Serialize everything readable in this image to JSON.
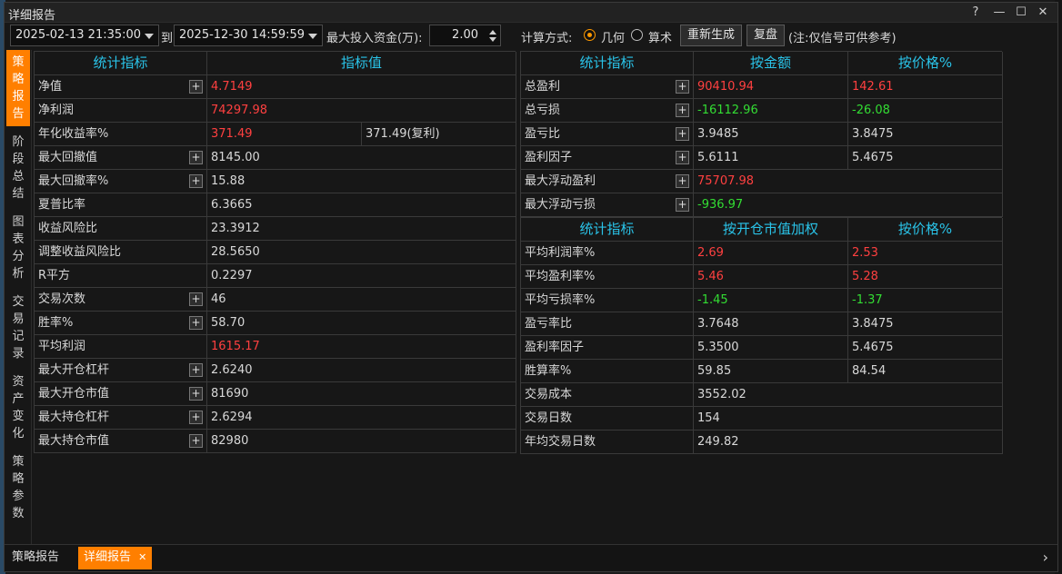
{
  "window": {
    "title": "详细报告"
  },
  "toolbar": {
    "start_datetime": "2025-02-13 21:35:00",
    "to_label": "到",
    "end_datetime": "2025-12-30 14:59:59",
    "max_capital_label": "最大投入资金(万):",
    "max_capital_value": "2.00",
    "calc_method_label": "计算方式:",
    "option_geometric": "几何",
    "option_arithmetic": "算术",
    "selected_method": "几何",
    "regenerate_label": "重新生成",
    "review_label": "复盘",
    "note": "(注:仅信号可供参考)"
  },
  "side_tabs": [
    {
      "label": "策略报告",
      "active": true
    },
    {
      "label": "阶段总结",
      "active": false
    },
    {
      "label": "图表分析",
      "active": false
    },
    {
      "label": "交易记录",
      "active": false
    },
    {
      "label": "资产变化",
      "active": false
    },
    {
      "label": "策略参数",
      "active": false
    }
  ],
  "left_table": {
    "headers": [
      "统计指标",
      "指标值"
    ],
    "rows": [
      {
        "name": "净值",
        "value": "4.7149",
        "extra": "",
        "plus": true,
        "color": "red"
      },
      {
        "name": "净利润",
        "value": "74297.98",
        "extra": "",
        "plus": false,
        "color": "red"
      },
      {
        "name": "年化收益率%",
        "value": "371.49",
        "extra": "371.49(复利)",
        "plus": false,
        "color": "red"
      },
      {
        "name": "最大回撤值",
        "value": "8145.00",
        "extra": "",
        "plus": true,
        "color": ""
      },
      {
        "name": "最大回撤率%",
        "value": "15.88",
        "extra": "",
        "plus": true,
        "color": ""
      },
      {
        "name": "夏普比率",
        "value": "6.3665",
        "extra": "",
        "plus": false,
        "color": ""
      },
      {
        "name": "收益风险比",
        "value": "23.3912",
        "extra": "",
        "plus": false,
        "color": ""
      },
      {
        "name": "调整收益风险比",
        "value": "28.5650",
        "extra": "",
        "plus": false,
        "color": ""
      },
      {
        "name": "R平方",
        "value": "0.2297",
        "extra": "",
        "plus": false,
        "color": ""
      },
      {
        "name": "交易次数",
        "value": "46",
        "extra": "",
        "plus": true,
        "color": ""
      },
      {
        "name": "胜率%",
        "value": "58.70",
        "extra": "",
        "plus": true,
        "color": ""
      },
      {
        "name": "平均利润",
        "value": "1615.17",
        "extra": "",
        "plus": false,
        "color": "red"
      },
      {
        "name": "最大开仓杠杆",
        "value": "2.6240",
        "extra": "",
        "plus": true,
        "color": ""
      },
      {
        "name": "最大开仓市值",
        "value": "81690",
        "extra": "",
        "plus": true,
        "color": ""
      },
      {
        "name": "最大持仓杠杆",
        "value": "2.6294",
        "extra": "",
        "plus": true,
        "color": ""
      },
      {
        "name": "最大持仓市值",
        "value": "82980",
        "extra": "",
        "plus": true,
        "color": ""
      }
    ]
  },
  "right_table_top": {
    "headers": [
      "统计指标",
      "按金额",
      "按价格%"
    ],
    "rows": [
      {
        "name": "总盈利",
        "amount": "90410.94",
        "price": "142.61",
        "plus": true,
        "color": "red"
      },
      {
        "name": "总亏损",
        "amount": "-16112.96",
        "price": "-26.08",
        "plus": true,
        "color": "green"
      },
      {
        "name": "盈亏比",
        "amount": "3.9485",
        "price": "3.8475",
        "plus": true,
        "color": ""
      },
      {
        "name": "盈利因子",
        "amount": "5.6111",
        "price": "5.4675",
        "plus": true,
        "color": ""
      },
      {
        "name": "最大浮动盈利",
        "amount": "75707.98",
        "price": "",
        "plus": true,
        "color": "red"
      },
      {
        "name": "最大浮动亏损",
        "amount": "-936.97",
        "price": "",
        "plus": true,
        "color": "green"
      }
    ]
  },
  "right_table_bottom": {
    "headers": [
      "统计指标",
      "按开仓市值加权",
      "按价格%"
    ],
    "rows": [
      {
        "name": "平均利润率%",
        "weighted": "2.69",
        "price": "2.53",
        "color": "red"
      },
      {
        "name": "平均盈利率%",
        "weighted": "5.46",
        "price": "5.28",
        "color": "red"
      },
      {
        "name": "平均亏损率%",
        "weighted": "-1.45",
        "price": "-1.37",
        "color": "green"
      },
      {
        "name": "盈亏率比",
        "weighted": "3.7648",
        "price": "3.8475",
        "color": ""
      },
      {
        "name": "盈利率因子",
        "weighted": "5.3500",
        "price": "5.4675",
        "color": ""
      },
      {
        "name": "胜算率%",
        "weighted": "59.85",
        "price": "84.54",
        "color": ""
      },
      {
        "name": "交易成本",
        "weighted": "3552.02",
        "price": "",
        "color": ""
      },
      {
        "name": "交易日数",
        "weighted": "154",
        "price": "",
        "color": ""
      },
      {
        "name": "年均交易日数",
        "weighted": "249.82",
        "price": "",
        "color": ""
      }
    ]
  },
  "bottom_tabs": [
    {
      "label": "策略报告",
      "active": false,
      "closable": false
    },
    {
      "label": "详细报告",
      "active": true,
      "closable": true
    }
  ],
  "colors": {
    "accent": "#ff7f00",
    "header_text": "#2ac3e8",
    "positive": "#ff4040",
    "negative": "#33dd33"
  }
}
